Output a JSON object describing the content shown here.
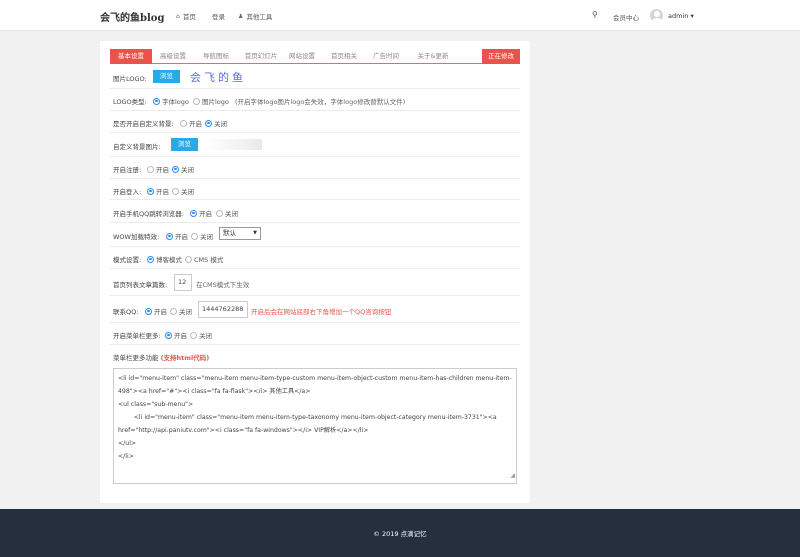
{
  "header": {
    "logo": "会飞的鱼blog",
    "nav": [
      {
        "icon": "home-icon",
        "label": "首页"
      },
      {
        "icon": "",
        "label": "登录"
      },
      {
        "icon": "user-icon",
        "label": "其他工具"
      }
    ],
    "member_center": "会员中心",
    "username": "admin"
  },
  "tabs": [
    {
      "label": "基本设置",
      "active": true
    },
    {
      "label": "高级设置"
    },
    {
      "label": "导航图标"
    },
    {
      "label": "首页幻灯片"
    },
    {
      "label": "网站设置"
    },
    {
      "label": "首页相关"
    },
    {
      "label": "广告时间"
    },
    {
      "label": "关于&更新"
    }
  ],
  "save_button": "正在修改",
  "settings": {
    "logo_image": {
      "label": "图片LOGO:",
      "button": "浏览",
      "preview_text": "会飞的鱼"
    },
    "logo_type": {
      "label": "LOGO类型:",
      "opt1": "字体logo",
      "opt2": "图片logo",
      "hint": "(开启字体logo图片logo会失效，字体logo修改替默认文件)"
    },
    "custom_bg": {
      "label": "是否开启自定义背景:",
      "opt1": "开启",
      "opt2": "关闭"
    },
    "bg_image": {
      "label": "自定义背景图片:",
      "button": "浏览"
    },
    "register": {
      "label": "开启注册:",
      "opt1": "开启",
      "opt2": "关闭"
    },
    "login": {
      "label": "开启登入:",
      "opt1": "开启",
      "opt2": "关闭"
    },
    "mobile_qq": {
      "label": "开启手机QQ跳转浏览器:",
      "opt1": "开启",
      "opt2": "关闭"
    },
    "wow": {
      "label": "WOW加载特效:",
      "opt1": "开启",
      "opt2": "关闭",
      "select": "默认"
    },
    "mode": {
      "label": "模式设置:",
      "opt1": "博客模式",
      "opt2": "CMS 模式"
    },
    "article_count": {
      "label": "首页列表文章篇数:",
      "value": "12",
      "hint": "在CMS模式下生效"
    },
    "contact_qq": {
      "label": "联系QQ:",
      "opt1": "开启",
      "opt2": "关闭",
      "value": "1444762288",
      "hint": "开启后会在网站底部右下角增加一个QQ咨询按钮"
    },
    "menu_more": {
      "label": "开启菜单栏更多:",
      "opt1": "开启",
      "opt2": "关闭"
    },
    "menu_html": {
      "label_prefix": "菜单栏更多功能",
      "label_suffix": "(支持html代码)",
      "lines": [
        "<li id=\"menu-item\" class=\"menu-item menu-item-type-custom menu-item-object-custom menu-item-has-children menu-item-498\"><a href=\"#\"><i class=\"fa fa-flask\"></i> 其他工具</a>",
        "<ul class=\"sub-menu\">",
        "        <li id=\"menu-item\" class=\"menu-item menu-item-type-taxonomy menu-item-object-category menu-item-3731\"><a href=\"http://api.paniutv.com\"><i class=\"fa fa-windows\"></i> VIP解析</a></li>",
        "</ul>",
        "</li>"
      ]
    }
  },
  "footer": "© 2019 点滴记忆"
}
